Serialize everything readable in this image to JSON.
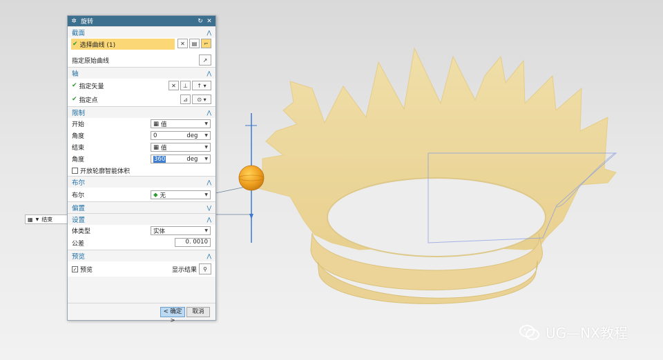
{
  "dialog": {
    "title": "旋转",
    "sections": {
      "section_label": "截面",
      "select_curve": "选择曲线 (1)",
      "specify_origin_curve": "指定原始曲线",
      "axis_label": "轴",
      "specify_vector": "指定矢量",
      "specify_point": "指定点",
      "limit_label": "限制",
      "start_label": "开始",
      "start_value": "值",
      "angle1_label": "角度",
      "angle1_value": "0",
      "angle_unit": "deg",
      "end_label": "结束",
      "end_value": "值",
      "angle2_label": "角度",
      "angle2_value": "360",
      "open_profile_label": "开放轮廓智能体积",
      "boolean_label": "布尔",
      "boolean_field_label": "布尔",
      "boolean_value": "无",
      "offset_label": "偏置",
      "settings_label": "设置",
      "body_type_label": "体类型",
      "body_type_value": "实体",
      "tolerance_label": "公差",
      "tolerance_value": "0. 0010",
      "preview_label": "预览",
      "preview_checkbox_label": "预览",
      "show_result_label": "显示结果"
    },
    "ok_label": "< 确定 >",
    "cancel_label": "取消"
  },
  "mini_toolbar": {
    "value": "结束"
  },
  "watermark": {
    "text": "UG—NX教程"
  },
  "colors": {
    "title_bar": "#3d6f8e",
    "section_header": "#1f6fa8",
    "selected_row": "#fbd775",
    "crown": "#f1d98f",
    "handle": "#f0a020",
    "axis": "#3a7ad0"
  },
  "icons": {
    "dialog_gear": "gear-icon",
    "reset": "reset-icon",
    "close": "close-icon",
    "collapse": "chevron-up-icon",
    "expand": "chevron-down-icon",
    "checkmark": "checkmark-icon",
    "curve_rule": "curve-rule-icon",
    "vector": "vector-icon",
    "point": "point-icon",
    "magnifier": "magnifier-icon",
    "wechat": "wechat-icon"
  }
}
